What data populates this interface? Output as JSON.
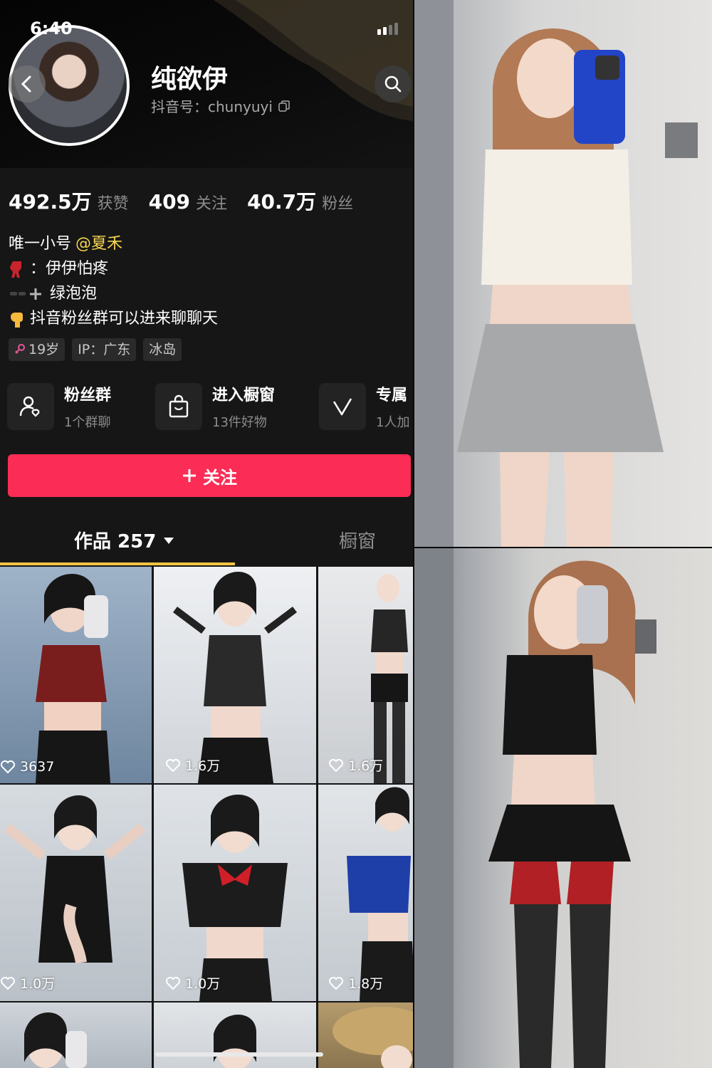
{
  "status": {
    "time": "6:40"
  },
  "profile": {
    "nickname": "纯欲伊",
    "douyin_id": "抖音号：chunyuyi"
  },
  "stats": [
    {
      "value": "492.5万",
      "label": "获赞"
    },
    {
      "value": "409",
      "label": "关注"
    },
    {
      "value": "40.7万",
      "label": "粉丝"
    }
  ],
  "bio": {
    "line1_prefix": "唯一小号",
    "line1_mention": "@夏禾",
    "line2": "：伊伊怕疼",
    "line3": "绿泡泡",
    "line4": "抖音粉丝群可以进来聊聊天"
  },
  "tags": {
    "age": "19岁",
    "ip": "IP：广东",
    "place": "冰岛"
  },
  "features": [
    {
      "title": "粉丝群",
      "sub": "1个群聊"
    },
    {
      "title": "进入橱窗",
      "sub": "13件好物"
    },
    {
      "title": "专属",
      "sub": "1人加"
    }
  ],
  "follow_button": "关注",
  "tabs": {
    "works": "作品 257",
    "showcase": "橱窗"
  },
  "videos": [
    {
      "likes": "3637"
    },
    {
      "likes": "1.6万"
    },
    {
      "likes": "1.6万"
    },
    {
      "likes": "1.0万"
    },
    {
      "likes": "1.0万"
    },
    {
      "likes": "1.8万"
    }
  ],
  "icons": [
    "back-icon",
    "search-icon",
    "copy-icon",
    "fan-group-icon",
    "shopping-bag-icon",
    "v-badge-icon",
    "plus-icon",
    "dropdown-triangle-icon",
    "heart-icon",
    "female-icon"
  ]
}
